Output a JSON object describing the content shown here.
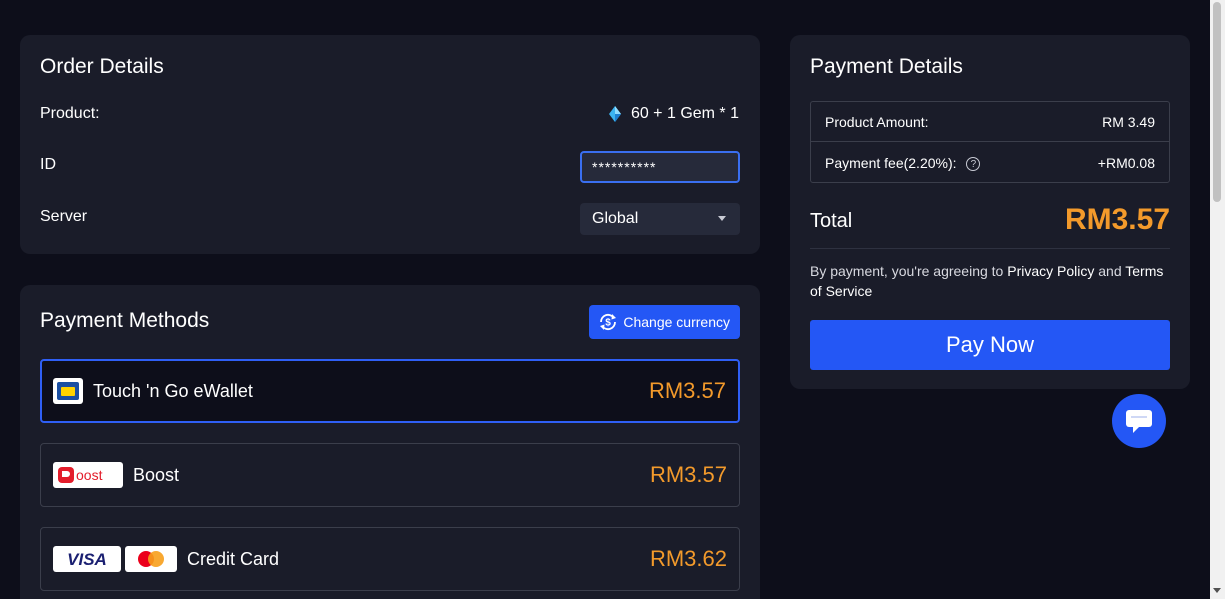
{
  "order": {
    "title": "Order Details",
    "product_label": "Product:",
    "product_value": "60 + 1 Gem * 1",
    "id_label": "ID",
    "id_value": "**********",
    "server_label": "Server",
    "server_value": "Global"
  },
  "payment_methods": {
    "title": "Payment Methods",
    "change_currency_label": "Change currency",
    "methods": [
      {
        "name": "Touch 'n Go eWallet",
        "price": "RM3.57",
        "selected": true
      },
      {
        "name": "Boost",
        "price": "RM3.57",
        "selected": false
      },
      {
        "name": "Credit Card",
        "price": "RM3.62",
        "selected": false
      }
    ]
  },
  "payment_details": {
    "title": "Payment Details",
    "product_amount_label": "Product Amount:",
    "product_amount_value": "RM 3.49",
    "payment_fee_label": "Payment fee(2.20%):",
    "payment_fee_value": "+RM0.08",
    "total_label": "Total",
    "total_value": "RM3.57",
    "agreement_prefix": "By payment, you're agreeing to ",
    "privacy_policy": "Privacy Policy",
    "agreement_and": " and ",
    "terms_of_service": "Terms of Service",
    "pay_now_label": "Pay Now"
  },
  "icons": {
    "gem": "gem-icon",
    "change_currency": "currency-exchange-icon",
    "help": "help-icon",
    "chat": "chat-icon",
    "dropdown": "chevron-down-icon"
  },
  "colors": {
    "background": "#0d0e1a",
    "card": "#1a1c29",
    "accent_blue": "#2457f5",
    "price_orange": "#f39a2b"
  }
}
